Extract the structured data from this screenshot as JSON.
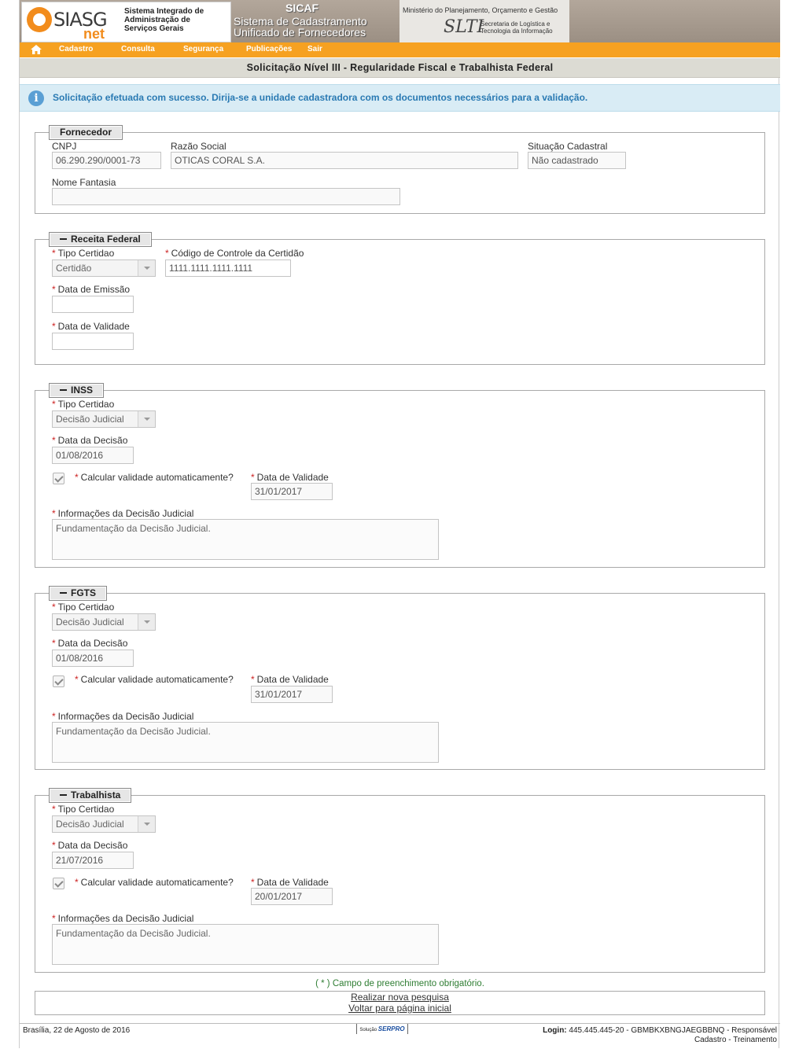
{
  "header": {
    "siasg_logo": "SIASG",
    "siasg_net": "net",
    "siasg_desc": [
      "Sistema Integrado de",
      "Administração de",
      "Serviços Gerais"
    ],
    "sicaf_title": "SICAF",
    "sicaf_sub": [
      "Sistema de Cadastramento",
      "Unificado de Fornecedores"
    ],
    "ministry": "Ministério do Planejamento, Orçamento e Gestão",
    "slti_logo": "SLTI",
    "slti_desc": [
      "Secretaria de Logística e",
      "Tecnologia da Informação"
    ]
  },
  "nav": {
    "items": [
      "Cadastro",
      "Consulta",
      "Segurança",
      "Publicações",
      "Sair"
    ]
  },
  "page_title": "Solicitação Nível III - Regularidade Fiscal e Trabalhista Federal",
  "info_message": "Solicitação efetuada com sucesso. Dirija-se a unidade cadastradora com os documentos necessários para a validação.",
  "fornecedor": {
    "legend": "Fornecedor",
    "cnpj_label": "CNPJ",
    "cnpj_value": "06.290.290/0001-73",
    "razao_label": "Razão Social",
    "razao_value": "OTICAS CORAL S.A.",
    "situacao_label": "Situação Cadastral",
    "situacao_value": "Não cadastrado",
    "fantasia_label": "Nome Fantasia",
    "fantasia_value": ""
  },
  "receita": {
    "legend": "Receita Federal",
    "tipo_label": "Tipo Certidao",
    "tipo_value": "Certidão",
    "codigo_label": "Código de Controle da Certidão",
    "codigo_value": "1111.1111.1111.1111",
    "emissao_label": "Data de Emissão",
    "emissao_value": "",
    "validade_label": "Data de Validade",
    "validade_value": ""
  },
  "inss": {
    "legend": "INSS",
    "tipo_label": "Tipo Certidao",
    "tipo_value": "Decisão Judicial",
    "decisao_label": "Data da Decisão",
    "decisao_value": "01/08/2016",
    "calc_label": "Calcular validade automaticamente?",
    "validade_label": "Data de Validade",
    "validade_value": "31/01/2017",
    "info_label": "Informações da Decisão Judicial",
    "info_value": "Fundamentação da Decisão Judicial."
  },
  "fgts": {
    "legend": "FGTS",
    "tipo_label": "Tipo Certidao",
    "tipo_value": "Decisão Judicial",
    "decisao_label": "Data da Decisão",
    "decisao_value": "01/08/2016",
    "calc_label": "Calcular validade automaticamente?",
    "validade_label": "Data de Validade",
    "validade_value": "31/01/2017",
    "info_label": "Informações da Decisão Judicial",
    "info_value": "Fundamentação da Decisão Judicial."
  },
  "trabalhista": {
    "legend": "Trabalhista",
    "tipo_label": "Tipo Certidao",
    "tipo_value": "Decisão Judicial",
    "decisao_label": "Data da Decisão",
    "decisao_value": "21/07/2016",
    "calc_label": "Calcular validade automaticamente?",
    "validade_label": "Data de Validade",
    "validade_value": "20/01/2017",
    "info_label": "Informações da Decisão Judicial",
    "info_value": "Fundamentação da Decisão Judicial."
  },
  "required_note": "( * ) Campo de preenchimento obrigatório.",
  "links": {
    "nova_pesquisa": "Realizar nova pesquisa",
    "voltar": "Voltar para página inicial"
  },
  "footer": {
    "date": "Brasília, 22 de Agosto de 2016",
    "serpro_prefix": "Solução",
    "serpro": "SERPRO",
    "login_label": "Login:",
    "login_value": "445.445.445-20 - GBMBKXBNGJAEGBBNQ - Responsável",
    "login_line2": "Cadastro - Treinamento"
  },
  "colors": {
    "nav": "#f6a121",
    "info_bg": "#d9ecf5",
    "info_text": "#2a7ab3",
    "required": "#cc2222"
  }
}
